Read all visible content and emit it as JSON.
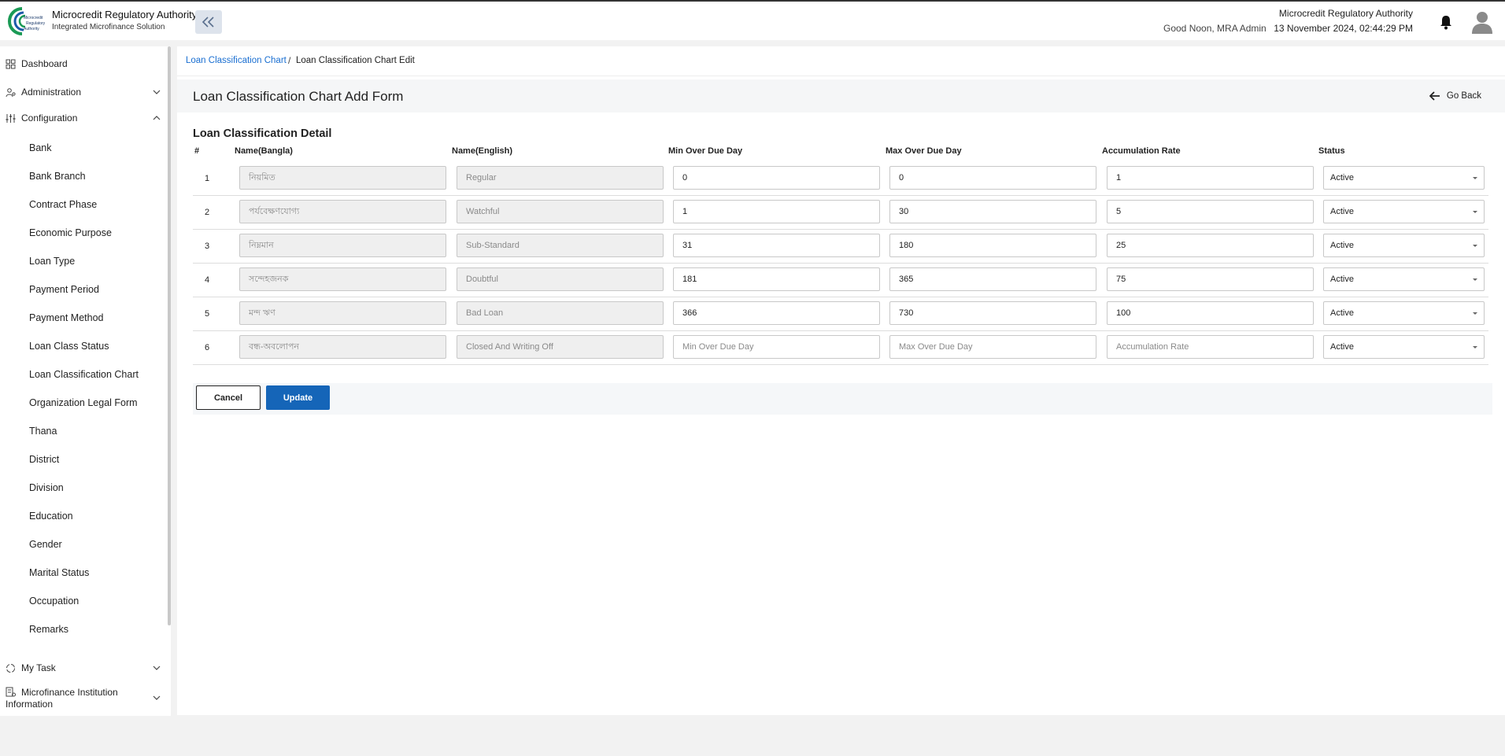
{
  "header": {
    "brand_title": "Microcredit Regulatory Authority",
    "brand_subtitle": "Integrated Microfinance Solution",
    "logo_text": [
      "Microcredit",
      "Regulatory",
      "Authority"
    ],
    "greeting": "Good Noon, MRA Admin",
    "org_name": "Microcredit Regulatory Authority",
    "datetime": "13 November 2024, 02:44:29 PM"
  },
  "sidebar": {
    "dashboard": "Dashboard",
    "administration": "Administration",
    "configuration": "Configuration",
    "config_items": [
      "Bank",
      "Bank Branch",
      "Contract Phase",
      "Economic Purpose",
      "Loan Type",
      "Payment Period",
      "Payment Method",
      "Loan Class Status",
      "Loan Classification Chart",
      "Organization Legal Form",
      "Thana",
      "District",
      "Division",
      "Education",
      "Gender",
      "Marital Status",
      "Occupation",
      "Remarks"
    ],
    "my_task": "My Task",
    "mfi_info_line1": "Microfinance Institution",
    "mfi_info_line2": "Information"
  },
  "breadcrumb": {
    "link": "Loan Classification Chart",
    "separator": "/",
    "current": "Loan Classification Chart Edit"
  },
  "form": {
    "title": "Loan Classification Chart Add Form",
    "go_back": "Go Back",
    "section_title": "Loan Classification Detail",
    "columns": [
      "#",
      "Name(Bangla)",
      "Name(English)",
      "Min Over Due Day",
      "Max Over Due Day",
      "Accumulation Rate",
      "Status"
    ],
    "placeholders": {
      "min": "Min Over Due Day",
      "max": "Max Over Due Day",
      "rate": "Accumulation Rate"
    },
    "rows": [
      {
        "num": "1",
        "bangla": "নিয়মিত",
        "english": "Regular",
        "min": "0",
        "max": "0",
        "rate": "1",
        "status": "Active"
      },
      {
        "num": "2",
        "bangla": "পর্যবেক্ষণযোগ্য",
        "english": "Watchful",
        "min": "1",
        "max": "30",
        "rate": "5",
        "status": "Active"
      },
      {
        "num": "3",
        "bangla": "নিম্নমান",
        "english": "Sub-Standard",
        "min": "31",
        "max": "180",
        "rate": "25",
        "status": "Active"
      },
      {
        "num": "4",
        "bangla": "সন্দেহজনক",
        "english": "Doubtful",
        "min": "181",
        "max": "365",
        "rate": "75",
        "status": "Active"
      },
      {
        "num": "5",
        "bangla": "মন্দ ঋণ",
        "english": "Bad Loan",
        "min": "366",
        "max": "730",
        "rate": "100",
        "status": "Active"
      },
      {
        "num": "6",
        "bangla": "বন্ধ-অবলোপন",
        "english": "Closed And Writing Off",
        "min": "",
        "max": "",
        "rate": "",
        "status": "Active"
      }
    ],
    "cancel_label": "Cancel",
    "update_label": "Update"
  },
  "colors": {
    "accent": "#1565b8",
    "link": "#1a6fd1",
    "logo_green": "#1a9a55",
    "logo_blue": "#1b5aa8"
  }
}
